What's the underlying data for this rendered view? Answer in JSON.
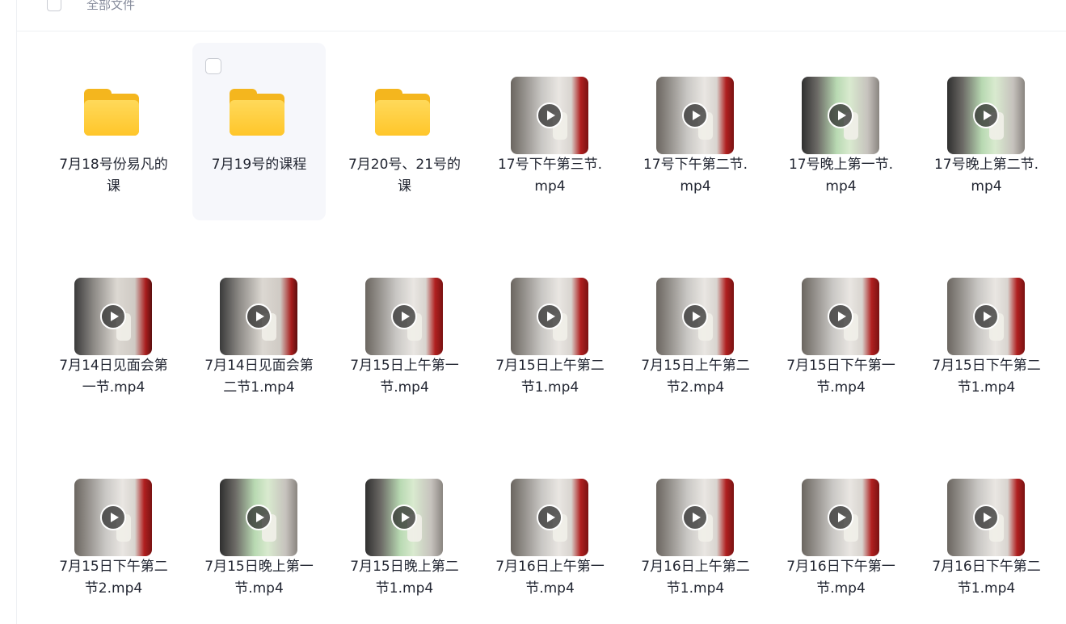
{
  "header": {
    "title": "全部文件"
  },
  "files": [
    {
      "name": "7月18号份易凡的课",
      "type": "folder"
    },
    {
      "name": "7月19号的课程",
      "type": "folder",
      "hover": true
    },
    {
      "name": "7月20号、21号的课",
      "type": "folder"
    },
    {
      "name": "17号下午第三节.mp4",
      "type": "video",
      "variant": "v1"
    },
    {
      "name": "17号下午第二节.mp4",
      "type": "video",
      "variant": "v1"
    },
    {
      "name": "17号晚上第一节.mp4",
      "type": "video",
      "variant": "v3"
    },
    {
      "name": "17号晚上第二节.mp4",
      "type": "video",
      "variant": "v3"
    },
    {
      "name": "7月14日见面会第一节.mp4",
      "type": "video",
      "variant": "v2"
    },
    {
      "name": "7月14日见面会第二节1.mp4",
      "type": "video",
      "variant": "v2"
    },
    {
      "name": "7月15日上午第一节.mp4",
      "type": "video",
      "variant": "v1"
    },
    {
      "name": "7月15日上午第二节1.mp4",
      "type": "video",
      "variant": "v1"
    },
    {
      "name": "7月15日上午第二节2.mp4",
      "type": "video",
      "variant": "v1"
    },
    {
      "name": "7月15日下午第一节.mp4",
      "type": "video",
      "variant": "v1"
    },
    {
      "name": "7月15日下午第二节1.mp4",
      "type": "video",
      "variant": "v1"
    },
    {
      "name": "7月15日下午第二节2.mp4",
      "type": "video",
      "variant": "v1"
    },
    {
      "name": "7月15日晚上第一节.mp4",
      "type": "video",
      "variant": "v3"
    },
    {
      "name": "7月15日晚上第二节1.mp4",
      "type": "video",
      "variant": "v3"
    },
    {
      "name": "7月16日上午第一节.mp4",
      "type": "video",
      "variant": "v1"
    },
    {
      "name": "7月16日上午第二节1.mp4",
      "type": "video",
      "variant": "v1"
    },
    {
      "name": "7月16日下午第一节.mp4",
      "type": "video",
      "variant": "v1"
    },
    {
      "name": "7月16日下午第二节1.mp4",
      "type": "video",
      "variant": "v1"
    }
  ]
}
